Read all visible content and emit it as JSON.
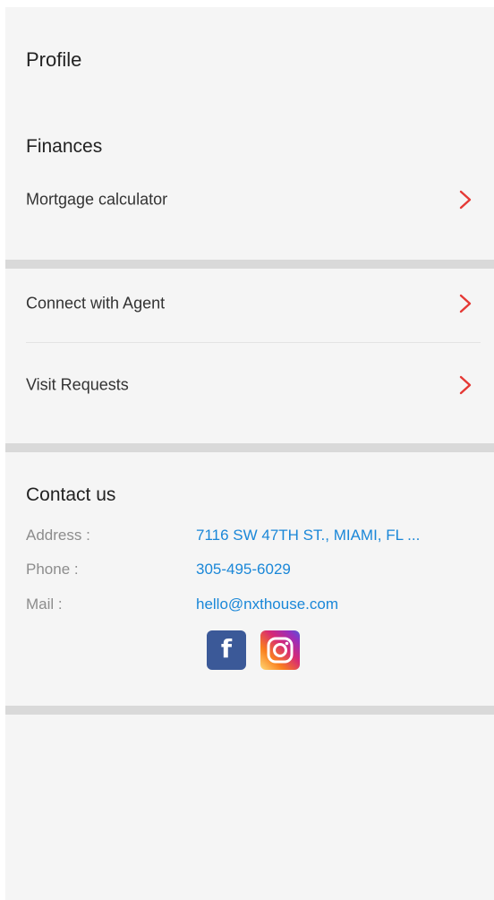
{
  "header": {
    "title": "Profile"
  },
  "finances": {
    "title": "Finances",
    "items": [
      {
        "label": "Mortgage calculator"
      }
    ]
  },
  "services": {
    "items": [
      {
        "label": "Connect with Agent"
      },
      {
        "label": "Visit Requests"
      }
    ]
  },
  "contact": {
    "title": "Contact us",
    "address_label": "Address :",
    "address_value": "7116 SW 47TH ST., MIAMI, FL ...",
    "phone_label": "Phone :",
    "phone_value": "305-495-6029",
    "mail_label": "Mail :",
    "mail_value": "hello@nxthouse.com",
    "social": [
      "facebook-icon",
      "instagram-icon"
    ]
  },
  "colors": {
    "accent_chevron": "#e53935",
    "link": "#1a87d8",
    "facebook": "#3b5998"
  }
}
